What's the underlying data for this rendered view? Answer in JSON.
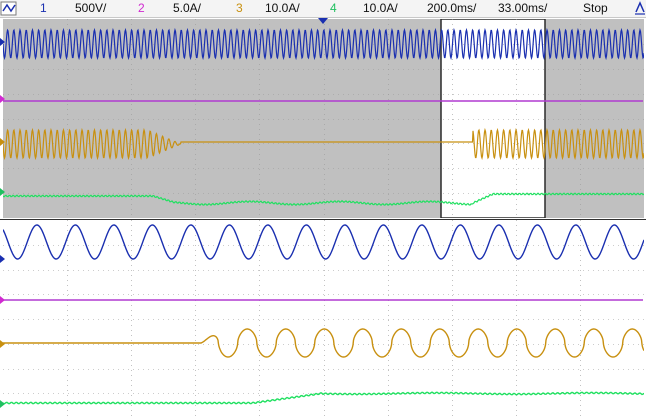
{
  "statusbar": {
    "ch1": {
      "num": "1",
      "scale": "500V/",
      "color": "#1a2fb0"
    },
    "ch2": {
      "num": "2",
      "scale": "5.0A/",
      "color": "#d02ad0"
    },
    "ch3": {
      "num": "3",
      "scale": "10.0A/",
      "color": "#c89010"
    },
    "ch4": {
      "num": "4",
      "scale": "10.0A/",
      "color": "#20c060"
    },
    "timebase": "200.0ms/",
    "delay": "33.00ms/",
    "run_state": "Stop"
  },
  "colors": {
    "overview_bg": "#c0c0c0",
    "zoom_window_bg": "#ffffff",
    "grid": "#9a9a9a",
    "ch1": "#1a2fb0",
    "ch2": "#b03ad0",
    "ch3": "#c89010",
    "ch4": "#20e060"
  }
}
